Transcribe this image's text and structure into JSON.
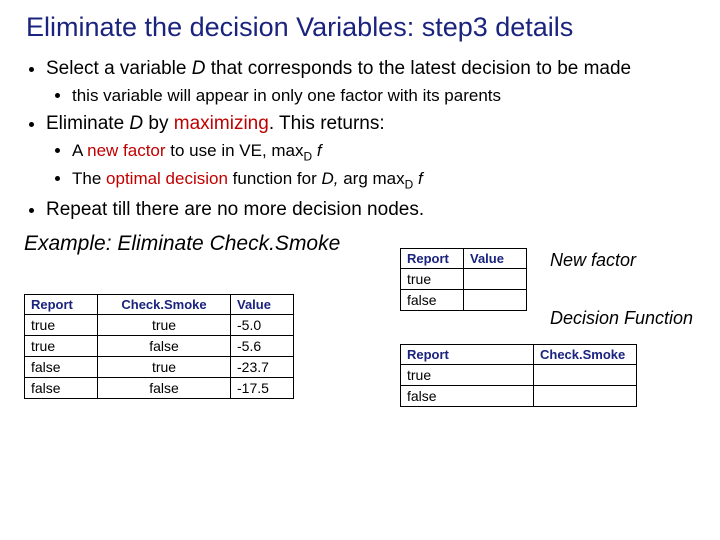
{
  "title": "Eliminate the decision Variables: step3 details",
  "b1": {
    "pre": "Select a variable ",
    "D": "D",
    "post": "  that corresponds to the latest decision to be made",
    "sub1": "this variable will appear in only one factor with its parents"
  },
  "b2": {
    "pre": "Eliminate ",
    "D": "D",
    "by": " by ",
    "max": "maximizing",
    "post": ". This returns:",
    "sub1": {
      "a": "A ",
      "nf": "new factor",
      "b": " to use in VE, max",
      "sub": "D",
      "c": " f"
    },
    "sub2": {
      "a": "The ",
      "od": "optimal decision",
      "b": " function for ",
      "D": "D,",
      "c": " arg max",
      "sub": "D",
      "d": " f"
    }
  },
  "b3": "Repeat till there are no more decision nodes.",
  "example": "Example: Eliminate Check.Smoke",
  "labels": {
    "newfactor": "New factor",
    "decfun": "Decision Function"
  },
  "t1": {
    "h": [
      "Report",
      "Check.Smoke",
      "Value"
    ],
    "r": [
      [
        "true",
        "true",
        "-5.0"
      ],
      [
        "true",
        "false",
        "-5.6"
      ],
      [
        "false",
        "true",
        "-23.7"
      ],
      [
        "false",
        "false",
        "-17.5"
      ]
    ]
  },
  "t2": {
    "h": [
      "Report",
      "Value"
    ],
    "r": [
      [
        "true",
        ""
      ],
      [
        "false",
        ""
      ]
    ]
  },
  "t3": {
    "h": [
      "Report",
      "Check.Smoke"
    ],
    "r": [
      [
        "true",
        ""
      ],
      [
        "false",
        ""
      ]
    ]
  }
}
